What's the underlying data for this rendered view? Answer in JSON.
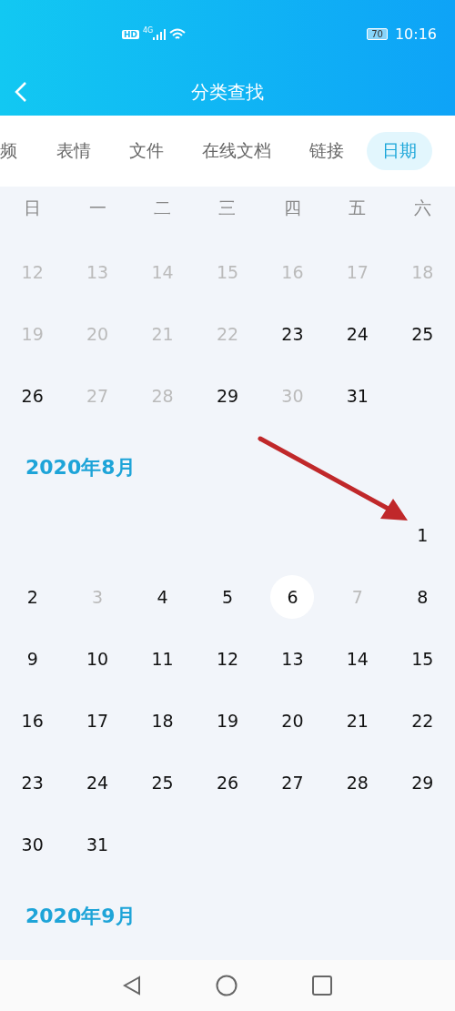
{
  "status_bar": {
    "hd": "HD",
    "network": "4G",
    "battery": "70",
    "time": "10:16"
  },
  "header": {
    "title": "分类查找"
  },
  "tabs": [
    {
      "label": "频",
      "selected": false
    },
    {
      "label": "表情",
      "selected": false
    },
    {
      "label": "文件",
      "selected": false
    },
    {
      "label": "在线文档",
      "selected": false
    },
    {
      "label": "链接",
      "selected": false
    },
    {
      "label": "日期",
      "selected": true
    }
  ],
  "weekdays": [
    "日",
    "一",
    "二",
    "三",
    "四",
    "五",
    "六"
  ],
  "months": [
    {
      "weeks": [
        [
          {
            "kind": "day",
            "day": "12",
            "active": false,
            "today": false
          },
          {
            "kind": "day",
            "day": "13",
            "active": false,
            "today": false
          },
          {
            "kind": "day",
            "day": "14",
            "active": false,
            "today": false
          },
          {
            "kind": "day",
            "day": "15",
            "active": false,
            "today": false
          },
          {
            "kind": "day",
            "day": "16",
            "active": false,
            "today": false
          },
          {
            "kind": "day",
            "day": "17",
            "active": false,
            "today": false
          },
          {
            "kind": "day",
            "day": "18",
            "active": false,
            "today": false
          }
        ],
        [
          {
            "kind": "day",
            "day": "19",
            "active": false,
            "today": false
          },
          {
            "kind": "day",
            "day": "20",
            "active": false,
            "today": false
          },
          {
            "kind": "day",
            "day": "21",
            "active": false,
            "today": false
          },
          {
            "kind": "day",
            "day": "22",
            "active": false,
            "today": false
          },
          {
            "kind": "day",
            "day": "23",
            "active": true,
            "today": false
          },
          {
            "kind": "day",
            "day": "24",
            "active": true,
            "today": false
          },
          {
            "kind": "day",
            "day": "25",
            "active": true,
            "today": false
          }
        ],
        [
          {
            "kind": "day",
            "day": "26",
            "active": true,
            "today": false
          },
          {
            "kind": "day",
            "day": "27",
            "active": false,
            "today": false
          },
          {
            "kind": "day",
            "day": "28",
            "active": false,
            "today": false
          },
          {
            "kind": "day",
            "day": "29",
            "active": true,
            "today": false
          },
          {
            "kind": "day",
            "day": "30",
            "active": false,
            "today": false
          },
          {
            "kind": "day",
            "day": "31",
            "active": true,
            "today": false
          },
          {
            "kind": "empty"
          }
        ]
      ]
    },
    {
      "title": "2020年8月",
      "weeks": [
        [
          {
            "kind": "empty"
          },
          {
            "kind": "empty"
          },
          {
            "kind": "empty"
          },
          {
            "kind": "empty"
          },
          {
            "kind": "empty"
          },
          {
            "kind": "empty"
          },
          {
            "kind": "day",
            "day": "1",
            "active": true,
            "today": false
          }
        ],
        [
          {
            "kind": "day",
            "day": "2",
            "active": true,
            "today": false
          },
          {
            "kind": "day",
            "day": "3",
            "active": false,
            "today": false
          },
          {
            "kind": "day",
            "day": "4",
            "active": true,
            "today": false
          },
          {
            "kind": "day",
            "day": "5",
            "active": true,
            "today": false
          },
          {
            "kind": "day",
            "day": "6",
            "active": true,
            "today": true
          },
          {
            "kind": "day",
            "day": "7",
            "active": false,
            "today": false
          },
          {
            "kind": "day",
            "day": "8",
            "active": true,
            "today": false
          }
        ],
        [
          {
            "kind": "day",
            "day": "9",
            "active": true,
            "today": false
          },
          {
            "kind": "day",
            "day": "10",
            "active": true,
            "today": false
          },
          {
            "kind": "day",
            "day": "11",
            "active": true,
            "today": false
          },
          {
            "kind": "day",
            "day": "12",
            "active": true,
            "today": false
          },
          {
            "kind": "day",
            "day": "13",
            "active": true,
            "today": false
          },
          {
            "kind": "day",
            "day": "14",
            "active": true,
            "today": false
          },
          {
            "kind": "day",
            "day": "15",
            "active": true,
            "today": false
          }
        ],
        [
          {
            "kind": "day",
            "day": "16",
            "active": true,
            "today": false
          },
          {
            "kind": "day",
            "day": "17",
            "active": true,
            "today": false
          },
          {
            "kind": "day",
            "day": "18",
            "active": true,
            "today": false
          },
          {
            "kind": "day",
            "day": "19",
            "active": true,
            "today": false
          },
          {
            "kind": "day",
            "day": "20",
            "active": true,
            "today": false
          },
          {
            "kind": "day",
            "day": "21",
            "active": true,
            "today": false
          },
          {
            "kind": "day",
            "day": "22",
            "active": true,
            "today": false
          }
        ],
        [
          {
            "kind": "day",
            "day": "23",
            "active": true,
            "today": false
          },
          {
            "kind": "day",
            "day": "24",
            "active": true,
            "today": false
          },
          {
            "kind": "day",
            "day": "25",
            "active": true,
            "today": false
          },
          {
            "kind": "day",
            "day": "26",
            "active": true,
            "today": false
          },
          {
            "kind": "day",
            "day": "27",
            "active": true,
            "today": false
          },
          {
            "kind": "day",
            "day": "28",
            "active": true,
            "today": false
          },
          {
            "kind": "day",
            "day": "29",
            "active": true,
            "today": false
          }
        ],
        [
          {
            "kind": "day",
            "day": "30",
            "active": true,
            "today": false
          },
          {
            "kind": "day",
            "day": "31",
            "active": true,
            "today": false
          },
          {
            "kind": "empty"
          },
          {
            "kind": "empty"
          },
          {
            "kind": "empty"
          },
          {
            "kind": "empty"
          },
          {
            "kind": "empty"
          }
        ]
      ]
    },
    {
      "title": "2020年9月"
    }
  ]
}
